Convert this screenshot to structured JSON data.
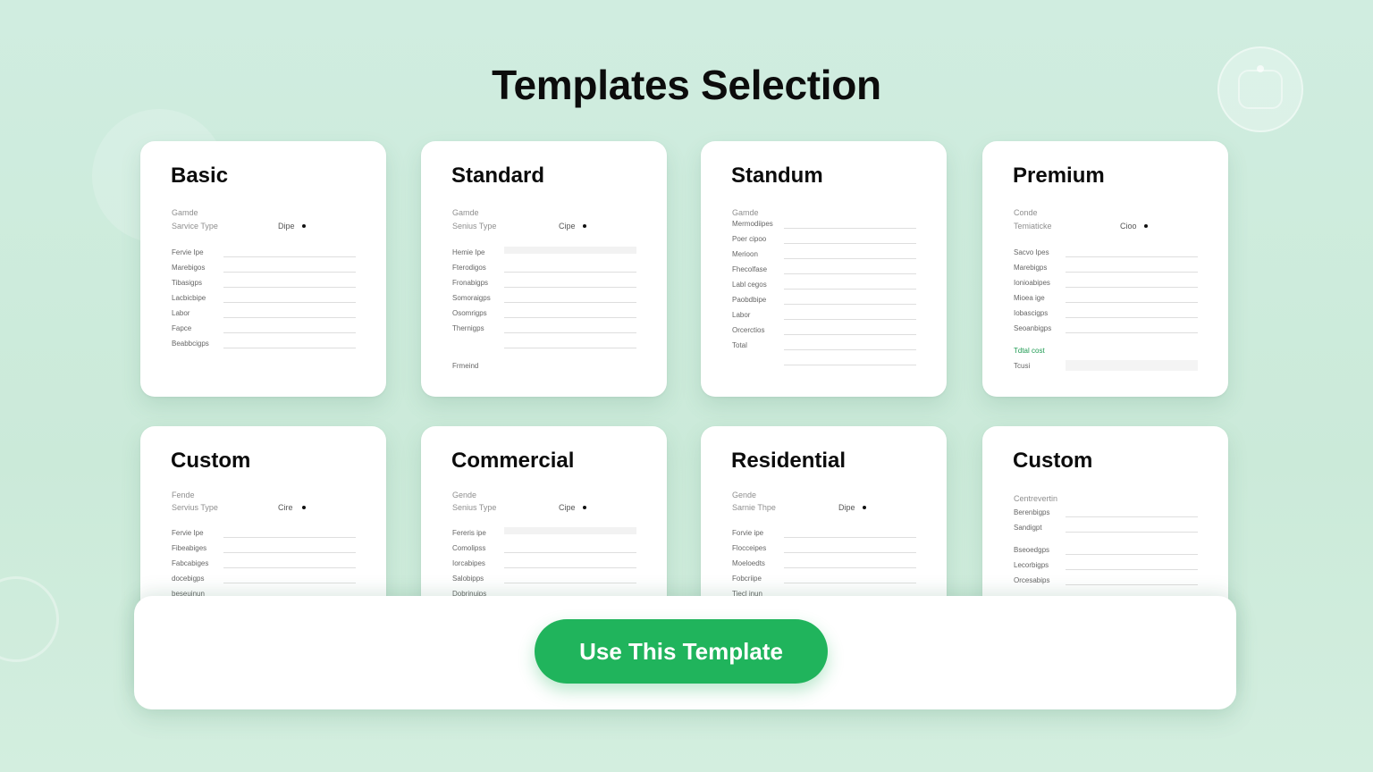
{
  "page": {
    "title": "Templates Selection"
  },
  "cards": [
    {
      "title": "Basic",
      "meta_label": "Gamde",
      "meta_key": "Sarvice Type",
      "meta_val": "Dipe",
      "rows": [
        "Fervie Ipe",
        "Marebigos",
        "Tibasigps",
        "Lacbicbipe",
        "Labor",
        "Fapce",
        "Beabbcigps"
      ]
    },
    {
      "title": "Standard",
      "meta_label": "Gamde",
      "meta_key": "Senius Type",
      "meta_val": "Cipe",
      "rows": [
        "Hemie Ipe",
        "Fterodigos",
        "Fronabigps",
        "Somoraigps",
        "Osomrigps",
        "Thernigps",
        "",
        "Frmeind"
      ]
    },
    {
      "title": "Standum",
      "meta_label": "Gamde",
      "rows": [
        "Mermodiipes",
        "Poer cipoo",
        "Merioon",
        "Fhecolfase",
        "Labl cegos",
        "Paobdbipe",
        "Labor",
        "Orcerctios",
        "Total",
        ""
      ]
    },
    {
      "title": "Premium",
      "meta_label": "Conde",
      "meta_key": "Temiaticke",
      "meta_val": "Cioo",
      "rows": [
        "Sacvo Ipes",
        "Marebigps",
        "Ionioabipes",
        "Mioea ige",
        "Iobascigps",
        "Seoanbigps",
        "Tdtal cost",
        "Tcusi"
      ]
    },
    {
      "title": "Custom",
      "meta_label": "Fende",
      "meta_key": "Servius Type",
      "meta_val": "Cire",
      "rows": [
        "Fervie Ipe",
        "Fibeabiges",
        "Fabcabiges",
        "docebigps",
        "beseuinun"
      ]
    },
    {
      "title": "Commercial",
      "meta_label": "Gende",
      "meta_key": "Senius Type",
      "meta_val": "Cipe",
      "rows": [
        "Fereris ipe",
        "Comolipss",
        "Iorcabipes",
        "Salobipps",
        "Dobrinuips"
      ]
    },
    {
      "title": "Residential",
      "meta_label": "Gende",
      "meta_key": "Sarnie Thpe",
      "meta_val": "Dipe",
      "rows": [
        "Forvie ipe",
        "Flocceipes",
        "Moeloedts",
        "Fobcriipe",
        "Tiecl inun"
      ]
    },
    {
      "title": "Custom",
      "meta_label": "Centrevertin",
      "rows": [
        "Berenbigps",
        "Sandigpt",
        "Bseoedgps",
        "Lecorbigps",
        "Orcesabips",
        ""
      ]
    }
  ],
  "actions": {
    "use_template_label": "Use This Template"
  },
  "colors": {
    "accent": "#20b45c",
    "total_cost": "#1e9a52",
    "background": "#cdebdc"
  }
}
